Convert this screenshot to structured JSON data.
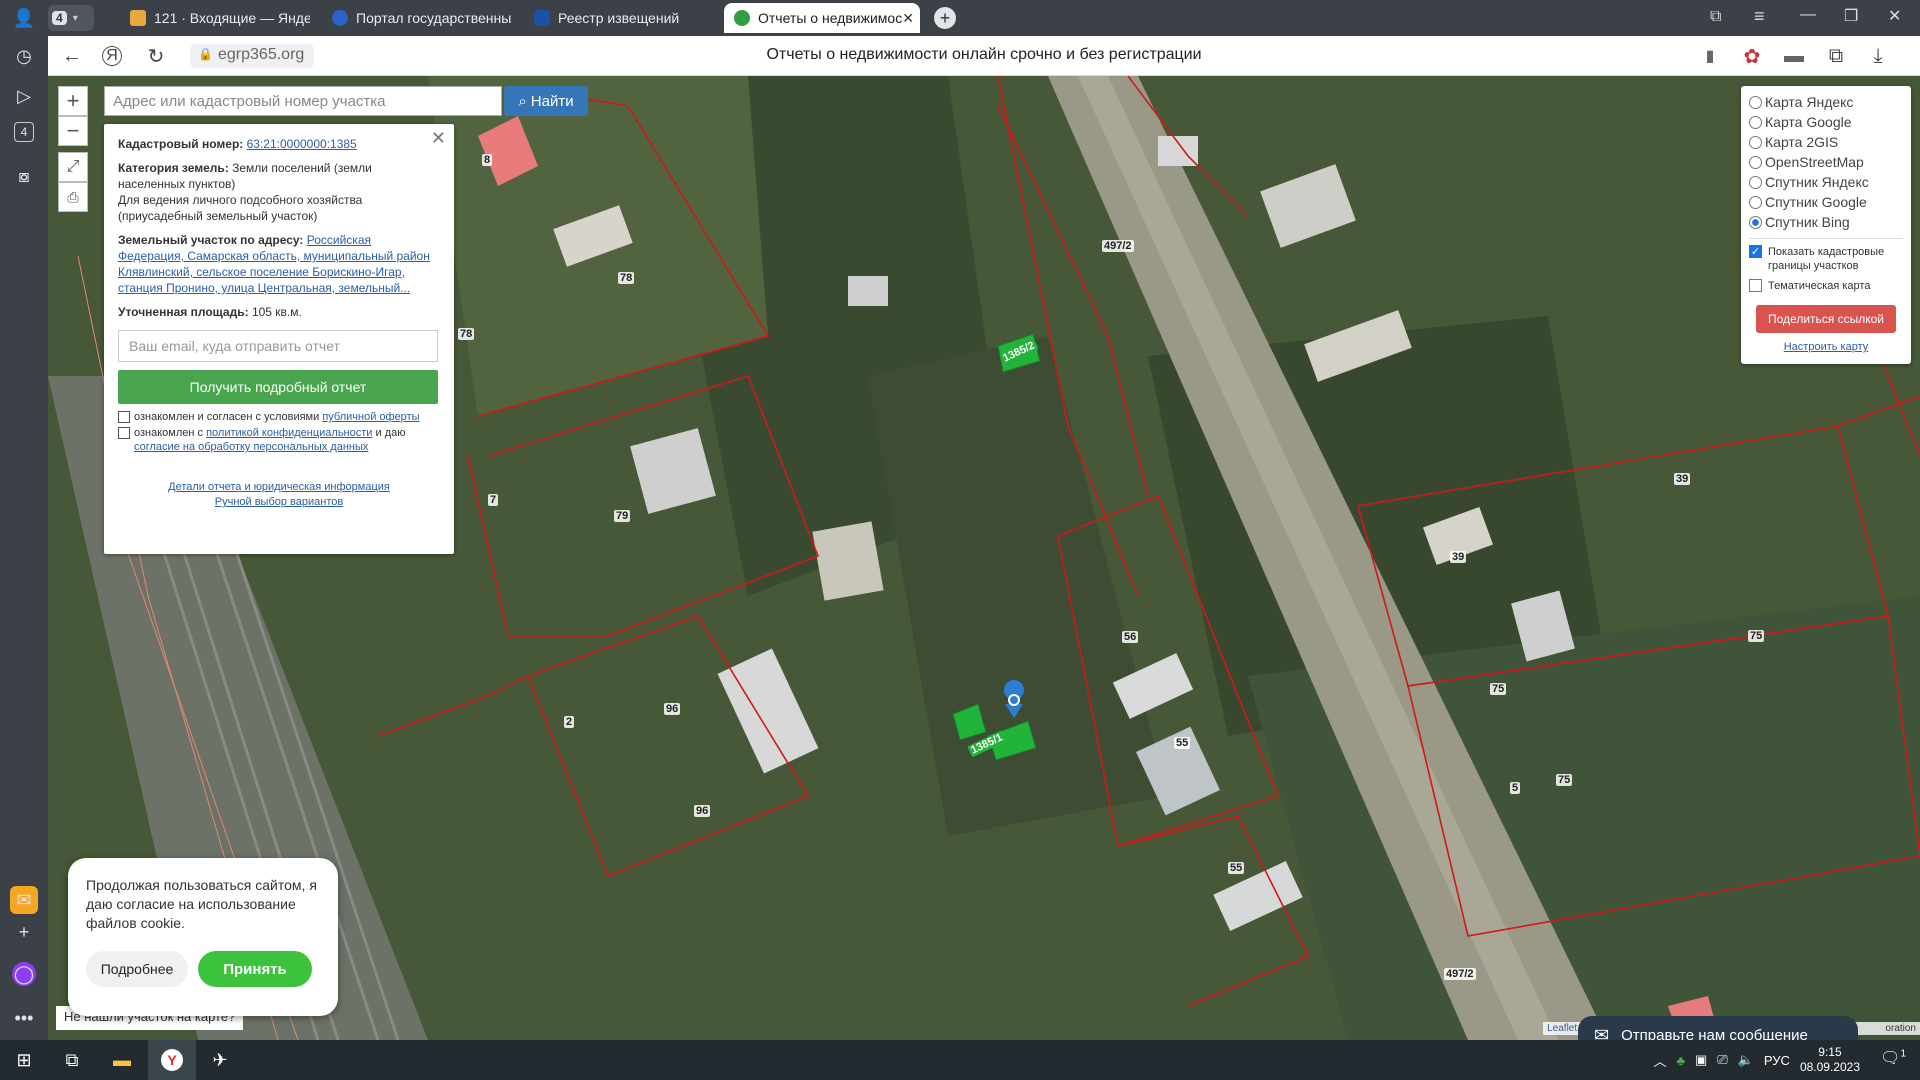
{
  "browser": {
    "tab_count": "4",
    "tabs": [
      {
        "label": "121 · Входящие — Яндекс",
        "favicon_color": "#e8a93a"
      },
      {
        "label": "Портал государственных",
        "favicon_color": "#2a63c9"
      },
      {
        "label": "Реестр извещений",
        "favicon_color": "#1f4fa0"
      },
      {
        "label": "Отчеты о недвижимос",
        "favicon_color": "#2ea043"
      }
    ],
    "url": "egrp365.org",
    "page_title": "Отчеты о недвижимости онлайн срочно и без регистрации"
  },
  "map": {
    "search_placeholder": "Адрес или кадастровый номер участка",
    "find_label": "Найти",
    "zoom_in": "+",
    "zoom_out": "−",
    "parcel_labels": [
      "78",
      "78",
      "79",
      "2",
      "96",
      "96",
      "1385/2",
      "1385/1",
      "56",
      "55",
      "55",
      "497/2",
      "497/2",
      "39",
      "39",
      "75",
      "75",
      "75",
      "8",
      "7",
      "5"
    ],
    "attribution": "Leaflet | © П",
    "attribution_right": "oration",
    "hidden_text": "Не нашли участок на карте?"
  },
  "info": {
    "cadastral_label": "Кадастровый номер:",
    "cadastral_value": "63:21:0000000:1385",
    "category_label": "Категория земель:",
    "category_value": "Земли поселений (земли населенных пунктов)",
    "usage": "Для ведения личного подсобного хозяйства (приусадебный земельный участок)",
    "address_label": "Земельный участок по адресу:",
    "address_value": "Российская Федерация, Самарская область, муниципальный район Клявлинский, сельское поселение Борискино-Игар, станция Пронино, улица Центральная, земельный...",
    "area_label": "Уточненная площадь:",
    "area_value": "105 кв.м.",
    "email_placeholder": "Ваш email, куда отправить отчет",
    "report_button": "Получить подробный отчет",
    "consent1_text": "ознакомлен и согласен с условиями",
    "consent1_link": "публичной оферты",
    "consent2_text": "ознакомлен с",
    "consent2_link": "политикой конфиденциальности",
    "consent2_mid": "и даю",
    "consent2_link2": "согласие на обработку персональных данных",
    "details_link": "Детали отчета и юридическая информация",
    "manual_link": "Ручной выбор вариантов"
  },
  "layers": {
    "options": [
      "Карта Яндекс",
      "Карта Google",
      "Карта 2GIS",
      "OpenStreetMap",
      "Спутник Яндекс",
      "Спутник Google",
      "Спутник Bing"
    ],
    "selected": "Спутник Bing",
    "show_borders": "Показать кадастровые границы участков",
    "thematic": "Тематическая карта",
    "share_button": "Поделиться ссылкой",
    "configure_link": "Настроить карту"
  },
  "cookie": {
    "text": "Продолжая пользоваться сайтом, я даю согласие на использование файлов cookie.",
    "more_button": "Подробнее",
    "accept_button": "Принять"
  },
  "chat": {
    "label": "Отправьте нам сообщение"
  },
  "taskbar": {
    "lang": "РУС",
    "time": "9:15",
    "date": "08.09.2023",
    "notif_count": "1"
  }
}
